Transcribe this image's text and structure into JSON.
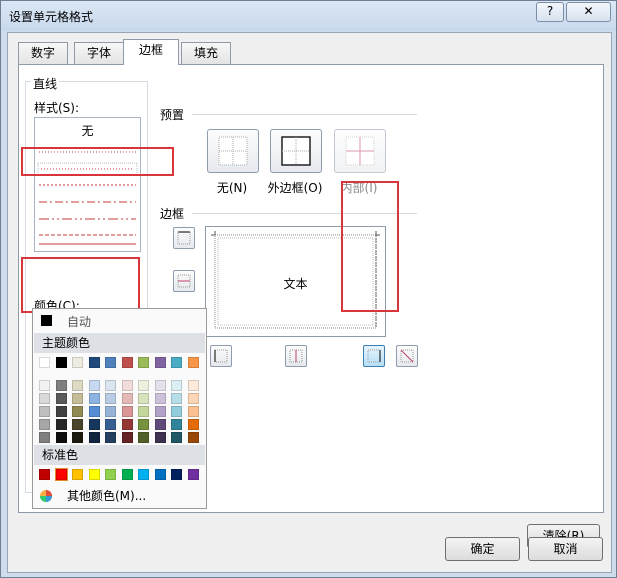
{
  "dialog": {
    "title": "设置单元格格式",
    "help_label": "?",
    "close_label": "✕"
  },
  "tabs": [
    {
      "label": "数字"
    },
    {
      "label": "字体"
    },
    {
      "label": "边框"
    },
    {
      "label": "填充"
    }
  ],
  "line_group": {
    "title": "直线",
    "style_label": "样式(S):",
    "none_label": "无",
    "color_label": "颜色(C):",
    "selected_color": "#ff0000"
  },
  "presets": {
    "title": "预置",
    "items": [
      {
        "label": "无(N)",
        "enabled": true
      },
      {
        "label": "外边框(O)",
        "enabled": true
      },
      {
        "label": "内部(I)",
        "enabled": false
      }
    ]
  },
  "border": {
    "title": "边框",
    "preview_text": "文本"
  },
  "palette": {
    "auto_label": "自动",
    "theme_title": "主题颜色",
    "standard_title": "标准色",
    "more_label": "其他颜色(M)...",
    "theme_colors": [
      [
        "#ffffff",
        "#f2f2f2",
        "#d9d9d9",
        "#bfbfbf",
        "#a6a6a6",
        "#7f7f7f"
      ],
      [
        "#000000",
        "#7f7f7f",
        "#595959",
        "#404040",
        "#262626",
        "#0d0d0d"
      ],
      [
        "#eeece1",
        "#ddd9c3",
        "#c4bd97",
        "#938953",
        "#494429",
        "#1d1b10"
      ],
      [
        "#1f497d",
        "#c6d9f0",
        "#8db3e2",
        "#548dd4",
        "#17365d",
        "#0f243e"
      ],
      [
        "#4f81bd",
        "#dbe5f1",
        "#b8cce4",
        "#95b3d7",
        "#366092",
        "#244061"
      ],
      [
        "#c0504d",
        "#f2dcdb",
        "#e5b9b7",
        "#d99694",
        "#953734",
        "#632423"
      ],
      [
        "#9bbb59",
        "#ebf1dd",
        "#d7e3bc",
        "#c3d69b",
        "#76923c",
        "#4f6128"
      ],
      [
        "#8064a2",
        "#e5e0ec",
        "#ccc1d9",
        "#b2a2c7",
        "#5f497a",
        "#3f3151"
      ],
      [
        "#4bacc6",
        "#dbeef3",
        "#b7dde8",
        "#92cddc",
        "#31859b",
        "#205867"
      ],
      [
        "#f79646",
        "#fdeada",
        "#fbd5b5",
        "#fac08f",
        "#e36c09",
        "#974806"
      ]
    ],
    "standard_colors": [
      "#c00000",
      "#ff0000",
      "#ffc000",
      "#ffff00",
      "#92d050",
      "#00b050",
      "#00b0f0",
      "#0070c0",
      "#002060",
      "#7030a0"
    ]
  },
  "buttons": {
    "clear": "清除(R)",
    "ok": "确定",
    "cancel": "取消"
  }
}
